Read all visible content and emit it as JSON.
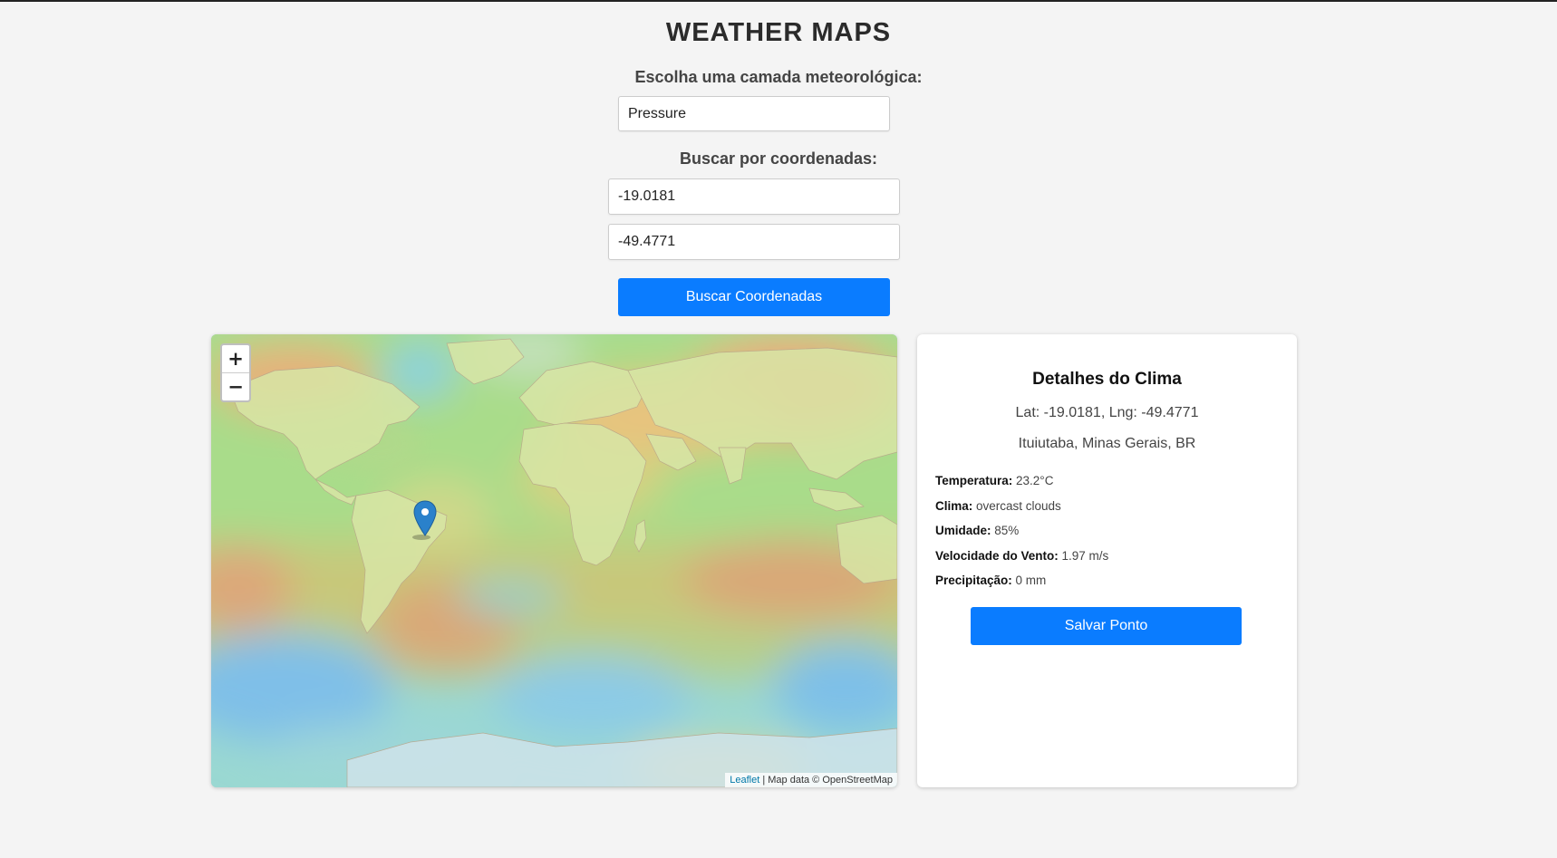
{
  "header": {
    "title": "WEATHER MAPS"
  },
  "layer": {
    "label": "Escolha uma camada meteorológica:",
    "selected": "Pressure"
  },
  "coords": {
    "label": "Buscar por coordenadas:",
    "lat_value": "-19.0181",
    "lng_value": "-49.4771",
    "search_button": "Buscar Coordenadas"
  },
  "map": {
    "zoom_in": "+",
    "zoom_out": "−",
    "attribution_link": "Leaflet",
    "attribution_text": " | Map data © OpenStreetMap"
  },
  "details": {
    "title": "Detalhes do Clima",
    "coords_line": "Lat: -19.0181, Lng: -49.4771",
    "location": "Ituiutaba, Minas Gerais, BR",
    "items": [
      {
        "label": "Temperatura:",
        "value": " 23.2°C"
      },
      {
        "label": "Clima:",
        "value": " overcast clouds"
      },
      {
        "label": "Umidade:",
        "value": " 85%"
      },
      {
        "label": "Velocidade do Vento:",
        "value": " 1.97 m/s"
      },
      {
        "label": "Precipitação:",
        "value": " 0 mm"
      }
    ],
    "save_button": "Salvar Ponto"
  },
  "colors": {
    "accent": "#0a7cff",
    "marker": "#2a81cb"
  }
}
